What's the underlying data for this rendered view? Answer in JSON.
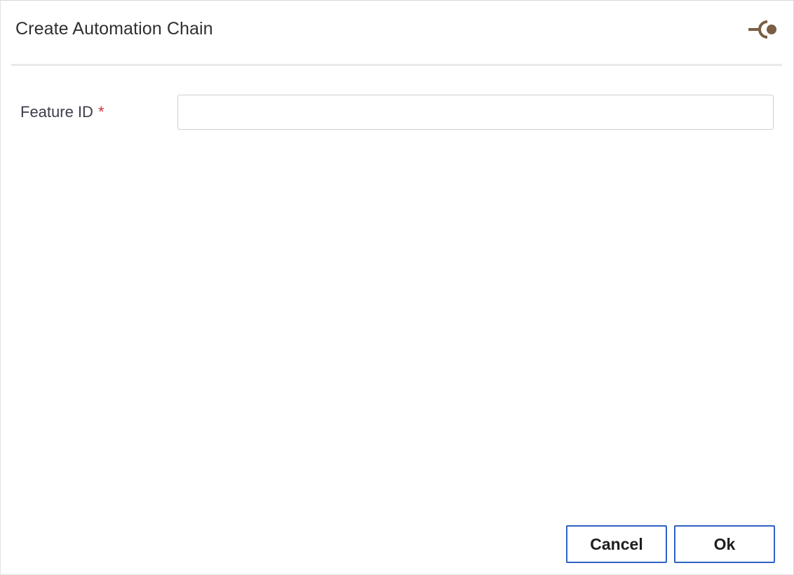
{
  "dialog": {
    "title": "Create Automation Chain",
    "pin_icon": "pin-icon",
    "accent_color": "#7a5f44"
  },
  "form": {
    "feature_id": {
      "label": "Feature ID",
      "required_marker": "*",
      "value": "",
      "placeholder": ""
    }
  },
  "footer": {
    "cancel_label": "Cancel",
    "ok_label": "Ok",
    "button_border_color": "#2f63c5"
  }
}
